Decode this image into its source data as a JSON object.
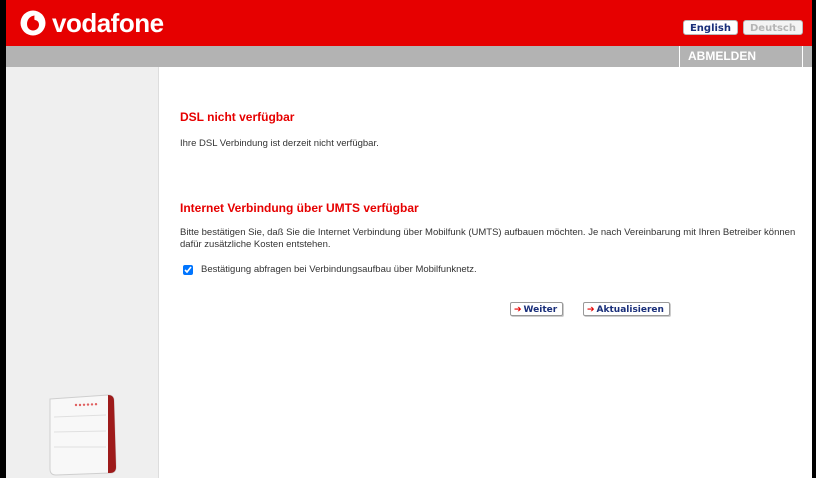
{
  "header": {
    "brand": "vodafone",
    "lang_english": "English",
    "lang_deutsch": "Deutsch"
  },
  "nav": {
    "logout": "ABMELDEN"
  },
  "main": {
    "section1_title": "DSL nicht verfügbar",
    "section1_text": "Ihre DSL Verbindung ist derzeit nicht verfügbar.",
    "section2_title": "Internet Verbindung über UMTS verfügbar",
    "section2_text": "Bitte bestätigen Sie, daß Sie die Internet Verbindung über Mobilfunk (UMTS) aufbauen möchten. Je nach Vereinbarung mit Ihren Betreiber können dafür zusätzliche Kosten entstehen.",
    "checkbox_label": "Bestätigung abfragen bei Verbindungsaufbau über Mobilfunknetz.",
    "checkbox_checked": true,
    "btn_next": "Weiter",
    "btn_refresh": "Aktualisieren"
  },
  "colors": {
    "brand_red": "#e60000",
    "nav_gray": "#b3b3b3",
    "sidebar_gray": "#efefef",
    "button_text_blue": "#1a2f7a"
  }
}
